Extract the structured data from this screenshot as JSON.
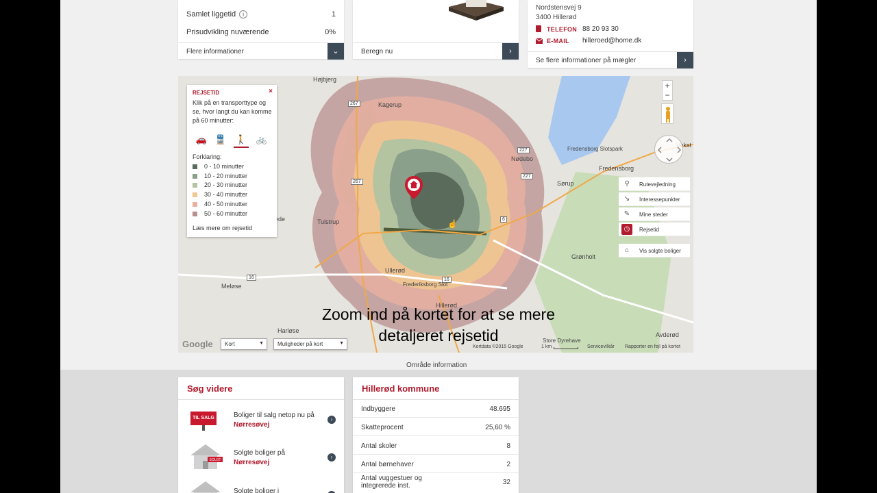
{
  "top_left": {
    "rows": [
      {
        "label": "Samlet liggetid",
        "value": "1"
      },
      {
        "label": "Prisudvikling nuværende",
        "value": "0%"
      }
    ],
    "more_label": "Flere informationer",
    "info_glyph": "i",
    "button_glyph": "⌄"
  },
  "top_middle": {
    "calc_label": "Beregn nu",
    "button_glyph": "›"
  },
  "top_right": {
    "address": "Nordstensvej 9",
    "city": "3400 Hillerød",
    "phone_label": "TELEFON",
    "phone": "88 20 93 30",
    "email_label": "E-MAIL",
    "email": "hilleroed@home.dk",
    "more_label": "Se flere informationer på mægler",
    "button_glyph": "›"
  },
  "map": {
    "legend": {
      "title": "REJSETID",
      "close": "×",
      "description": "Klik på en transporttype og se, hvor langt du kan komme på 60 minutter:",
      "explanation_label": "Forklaring:",
      "items": [
        {
          "label": "0 - 10 minutter",
          "color": "#5b6b5b"
        },
        {
          "label": "10 - 20 minutter",
          "color": "#8aa08a"
        },
        {
          "label": "20 - 30 minutter",
          "color": "#b4c4a0"
        },
        {
          "label": "30 - 40 minutter",
          "color": "#f0c890"
        },
        {
          "label": "40 - 50 minutter",
          "color": "#e8b0a0"
        },
        {
          "label": "50 - 60 minutter",
          "color": "#b89090"
        }
      ],
      "read_more": "Læs mere om rejsetid",
      "transport": [
        {
          "name": "car-icon",
          "glyph": "🚗"
        },
        {
          "name": "train-icon",
          "glyph": "🚆"
        },
        {
          "name": "walk-icon",
          "glyph": "🚶"
        },
        {
          "name": "bike-icon",
          "glyph": "🚲"
        }
      ]
    },
    "places": [
      {
        "name": "Højbjerg"
      },
      {
        "name": "Kagerup"
      },
      {
        "name": "Nødebo"
      },
      {
        "name": "Fredensborg"
      },
      {
        "name": "Fredensborg Slotspark"
      },
      {
        "name": "Sørup"
      },
      {
        "name": "Tulstrup"
      },
      {
        "name": "Ullerød"
      },
      {
        "name": "Frederiksborg Slot"
      },
      {
        "name": "Hillerød"
      },
      {
        "name": "Meløse"
      },
      {
        "name": "Harløse"
      },
      {
        "name": "Grønholt"
      },
      {
        "name": "Avderød"
      },
      {
        "name": "Store Dyrehave"
      },
      {
        "name": "Vekst"
      },
      {
        "name": "ede"
      }
    ],
    "roads": [
      "267",
      "267",
      "227",
      "227",
      "16",
      "16",
      "6"
    ],
    "overlay_message": "Zoom ind på kortet for at se mere detaljeret rejsetid",
    "side_items": [
      {
        "label": "Rutevejledning",
        "icon": "route-icon",
        "glyph": "⚲"
      },
      {
        "label": "Interessepunkter",
        "icon": "poi-icon",
        "glyph": "↘"
      },
      {
        "label": "Mine steder",
        "icon": "ruler-icon",
        "glyph": "✎"
      },
      {
        "label": "Rejsetid",
        "icon": "clock-icon",
        "glyph": "◷"
      },
      {
        "label": "Vis solgte boliger",
        "icon": "house-icon",
        "glyph": "⌂"
      }
    ],
    "map_type": "Kort",
    "options": "Muligheder på kort",
    "google": "Google",
    "attribution": "Kortdata ©2015 Google",
    "scale": "1 km",
    "service_terms": "Servicevilkår",
    "report": "Rapporter en fejl på kortet",
    "zoom_in": "+",
    "zoom_out": "−"
  },
  "area_info": "Område information",
  "search_further": {
    "title": "Søg videre",
    "items": [
      {
        "text": "Boliger til salg netop nu på",
        "bold": "Nørresøvej",
        "badge": "TIL SALG"
      },
      {
        "text": "Solgte boliger på",
        "bold": "Nørresøvej",
        "badge": "SOLGT"
      },
      {
        "text": "Solgte boliger i",
        "bold": "",
        "badge": ""
      }
    ]
  },
  "municipality": {
    "title": "Hillerød kommune",
    "rows": [
      {
        "label": "Indbyggere",
        "value": "48.695"
      },
      {
        "label": "Skatteprocent",
        "value": "25,60 %"
      },
      {
        "label": "Antal skoler",
        "value": "8"
      },
      {
        "label": "Antal børnehaver",
        "value": "2"
      },
      {
        "label": "Antal vuggestuer og integrerede inst.",
        "value": "32"
      }
    ]
  }
}
